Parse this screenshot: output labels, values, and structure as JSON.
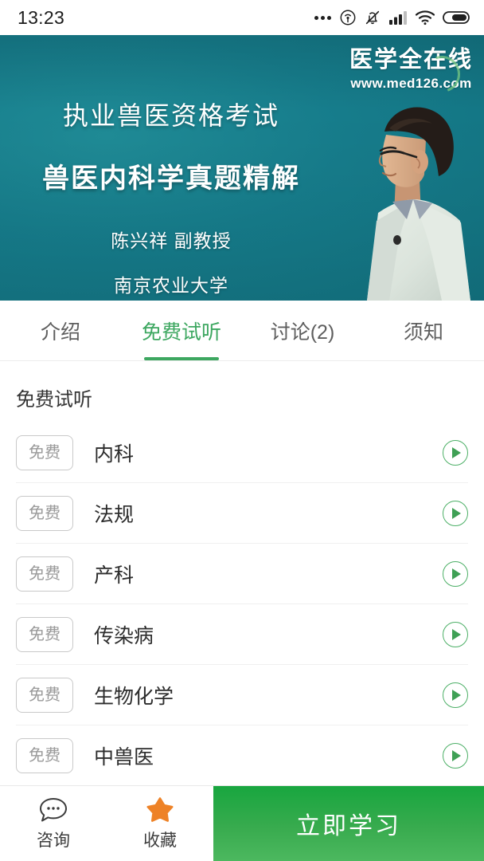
{
  "statusbar": {
    "time": "13:23",
    "icons": [
      "more-dots-icon",
      "cast-icon",
      "bell-muted-icon",
      "signal-icon",
      "wifi-icon",
      "battery-icon"
    ]
  },
  "banner": {
    "watermark_cn": "医学全在线",
    "watermark_url": "www.med126.com",
    "title_line1": "执业兽医资格考试",
    "title_line2": "兽医内科学真题精解",
    "lecturer": "陈兴祥  副教授",
    "institution": "南京农业大学",
    "bg_color": "#177d8c"
  },
  "tabs": [
    {
      "label": "介绍",
      "active": false
    },
    {
      "label": "免费试听",
      "active": true
    },
    {
      "label": "讨论(2)",
      "active": false
    },
    {
      "label": "须知",
      "active": false
    }
  ],
  "section": {
    "title": "免费试听"
  },
  "lessons": [
    {
      "badge": "免费",
      "title": "内科"
    },
    {
      "badge": "免费",
      "title": "法规"
    },
    {
      "badge": "免费",
      "title": "产科"
    },
    {
      "badge": "免费",
      "title": "传染病"
    },
    {
      "badge": "免费",
      "title": "生物化学"
    },
    {
      "badge": "免费",
      "title": "中兽医"
    }
  ],
  "bottombar": {
    "consult_label": "咨询",
    "favorite_label": "收藏",
    "cta_label": "立即学习",
    "cta_color": "#2ca84a",
    "star_color": "#ee8227"
  },
  "accent_color": "#3da760"
}
